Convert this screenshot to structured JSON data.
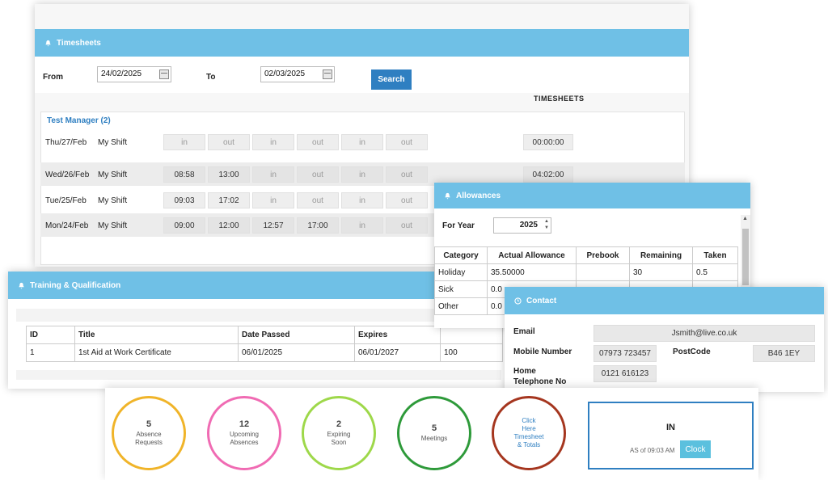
{
  "timesheets": {
    "title": "Timesheets",
    "from_label": "From",
    "from_value": "24/02/2025",
    "to_label": "To",
    "to_value": "02/03/2025",
    "search_label": "Search",
    "column_header": "TIMESHEETS",
    "group_label": "Test Manager (2)",
    "rows": [
      {
        "date": "Thu/27/Feb",
        "shift": "My Shift",
        "cells": [
          "in",
          "out",
          "in",
          "out",
          "in",
          "out"
        ],
        "total": "00:00:00"
      },
      {
        "date": "Wed/26/Feb",
        "shift": "My Shift",
        "cells": [
          "08:58",
          "13:00",
          "in",
          "out",
          "in",
          "out"
        ],
        "total": "04:02:00"
      },
      {
        "date": "Tue/25/Feb",
        "shift": "My Shift",
        "cells": [
          "09:03",
          "17:02",
          "in",
          "out",
          "in",
          "out"
        ],
        "total": ""
      },
      {
        "date": "Mon/24/Feb",
        "shift": "My Shift",
        "cells": [
          "09:00",
          "12:00",
          "12:57",
          "17:00",
          "in",
          "out"
        ],
        "total": ""
      }
    ]
  },
  "allowances": {
    "title": "Allowances",
    "for_year_label": "For Year",
    "year_value": "2025",
    "headers": [
      "Category",
      "Actual Allowance",
      "Prebook",
      "Remaining",
      "Taken"
    ],
    "rows": [
      [
        "Holiday",
        "35.50000",
        "",
        "30",
        "0.5"
      ],
      [
        "Sick",
        "0.0",
        "",
        "",
        ""
      ],
      [
        "Other",
        "0.0",
        "",
        "",
        ""
      ]
    ]
  },
  "training": {
    "title": "Training & Qualification",
    "headers": [
      "ID",
      "Title",
      "Date Passed",
      "Expires"
    ],
    "rows": [
      [
        "1",
        "1st Aid at Work Certificate",
        "06/01/2025",
        "06/01/2027",
        "100"
      ]
    ]
  },
  "contact": {
    "title": "Contact",
    "email_label": "Email",
    "email_value": "Jsmith@live.co.uk",
    "mobile_label": "Mobile Number",
    "mobile_value": "07973 723457",
    "postcode_label": "PostCode",
    "postcode_value": "B46 1EY",
    "home_label_1": "Home",
    "home_label_2": "Telephone No",
    "home_value": "0121 616123"
  },
  "circles": [
    {
      "num": "5",
      "label1": "Absence",
      "label2": "Requests",
      "label3": "",
      "color": "#f0b429"
    },
    {
      "num": "12",
      "label1": "Upcoming",
      "label2": "Absences",
      "label3": "",
      "color": "#f06bb3"
    },
    {
      "num": "2",
      "label1": "Expiring",
      "label2": "Soon",
      "label3": "",
      "color": "#9ed84a"
    },
    {
      "num": "5",
      "label1": "Meetings",
      "label2": "",
      "label3": "",
      "color": "#2e9a3a"
    },
    {
      "num": "",
      "label1": "Click",
      "label2": "Here",
      "label3": "Timesheet",
      "label4": "& Totals",
      "color": "#a5361f"
    }
  ],
  "clock": {
    "status": "IN",
    "as_of": "AS of 09:03 AM",
    "button_label": "Clock"
  }
}
